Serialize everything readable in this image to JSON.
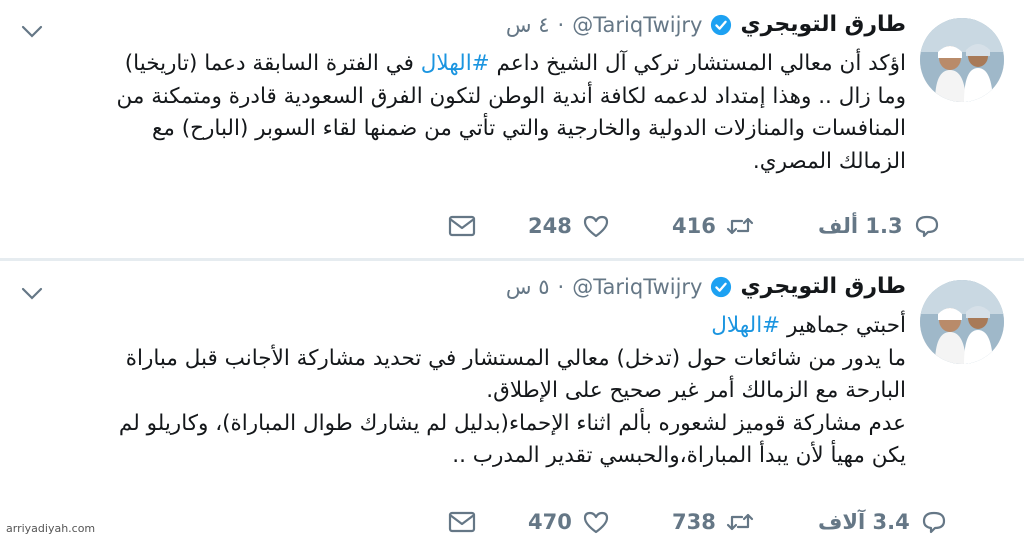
{
  "tweets": [
    {
      "name": "طارق التويجري",
      "handle": "@TariqTwijry",
      "dot": "·",
      "time": "٤ س",
      "text_before_hashtag": "اؤكد أن معالي المستشار تركي آل الشيخ داعم ",
      "hashtag": "#الهلال",
      "text_after_hashtag": " في الفترة السابقة دعما (تاريخيا) وما زال .. وهذا إمتداد لدعمه لكافة أندية الوطن لتكون الفرق السعودية قادرة ومتمكنة من المنافسات والمنازلات الدولية والخارجية والتي تأتي من ضمنها لقاء السوبر (البارح) مع الزمالك المصري.",
      "replies": "1.3 ألف",
      "retweets": "416",
      "likes": "248"
    },
    {
      "name": "طارق التويجري",
      "handle": "@TariqTwijry",
      "dot": "·",
      "time": "٥ س",
      "text_line1_before_hashtag": "أحبتي جماهير ",
      "hashtag": "#الهلال",
      "text_rest": "ما يدور من شائعات حول (تدخل) معالي المستشار في تحديد مشاركة الأجانب قبل مباراة البارحة مع الزمالك أمر غير صحيح على الإطلاق.",
      "text_rest2": "عدم مشاركة قوميز لشعوره بألم اثناء الإحماء(بدليل لم يشارك طوال المباراة)، وكاريلو لم يكن مهيأ لأن يبدأ المباراة،والحبسي تقدير المدرب ..",
      "replies": "3.4 آلاف",
      "retweets": "738",
      "likes": "470"
    }
  ],
  "footer": {
    "credit": "arriyadiyah.com"
  },
  "colors": {
    "accent": "#1b95e0",
    "muted": "#657786",
    "verified": "#1da1f2"
  },
  "icons": [
    "chevron-down-icon",
    "verified-icon",
    "reply-icon",
    "retweet-icon",
    "like-icon",
    "message-icon"
  ]
}
